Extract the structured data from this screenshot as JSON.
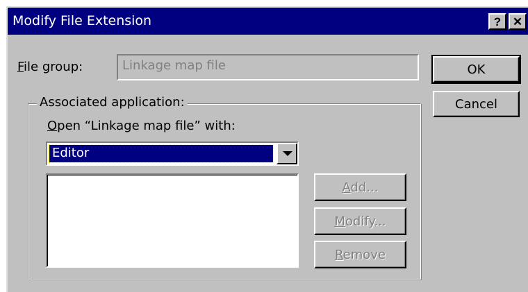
{
  "dialog": {
    "title": "Modify File Extension",
    "help_button": "?",
    "close_button": "✕"
  },
  "file_group": {
    "label_mnemonic": "F",
    "label_rest": "ile group:",
    "value": "Linkage map file"
  },
  "associated_application": {
    "group_label": "Associated application:",
    "open_with_mnemonic": "O",
    "open_with_rest": "pen “Linkage map file” with:",
    "combo_value": "Editor",
    "list_items": []
  },
  "buttons": {
    "ok": "OK",
    "cancel": "Cancel",
    "add_mnemonic": "A",
    "add_rest": "dd...",
    "modify_mnemonic": "M",
    "modify_rest": "odify...",
    "remove_mnemonic": "R",
    "remove_rest": "emove"
  },
  "colors": {
    "titlebar": "#000080",
    "face": "#c0c0c0",
    "selection": "#000080"
  }
}
